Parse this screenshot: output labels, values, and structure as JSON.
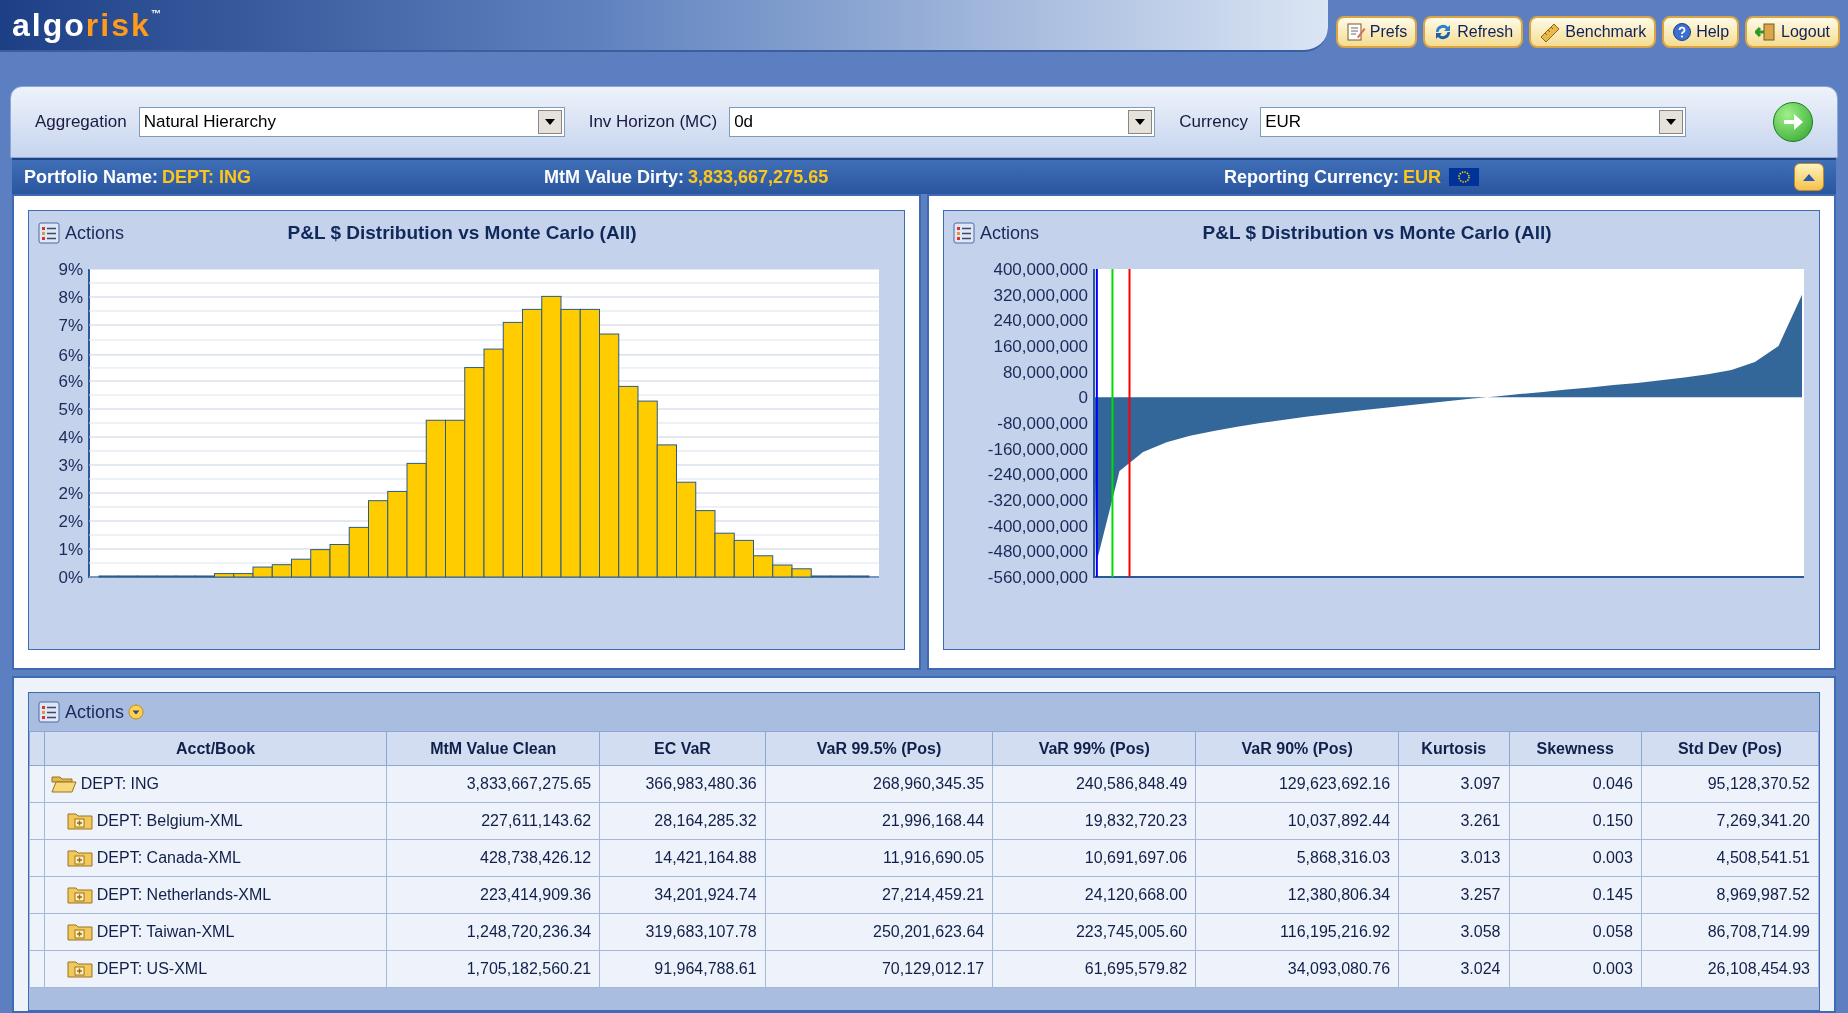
{
  "header": {
    "logo": {
      "first": "algo",
      "second": "risk",
      "mark": "™"
    },
    "buttons": [
      {
        "label": "Prefs"
      },
      {
        "label": "Refresh"
      },
      {
        "label": "Benchmark"
      },
      {
        "label": "Help"
      },
      {
        "label": "Logout"
      }
    ]
  },
  "filters": [
    {
      "label": "Aggregation",
      "value": "Natural Hierarchy"
    },
    {
      "label": "Inv Horizon (MC)",
      "value": "0d"
    },
    {
      "label": "Currency",
      "value": "EUR"
    }
  ],
  "info_bar": [
    {
      "label": "Portfolio Name:",
      "value": "DEPT: ING"
    },
    {
      "label": "MtM Value Dirty:",
      "value": "3,833,667,275.65"
    },
    {
      "label": "Reporting Currency:",
      "value": "EUR"
    }
  ],
  "charts": [
    {
      "actions": "Actions",
      "chart_data": {
        "type": "bar",
        "title": "P&L $ Distribution vs Monte Carlo (All)",
        "ylim": [
          0,
          9
        ],
        "yticks": [
          {
            "value": 0,
            "label": "0%"
          },
          {
            "value": 0.818,
            "label": "1%"
          },
          {
            "value": 1.636,
            "label": "2%"
          },
          {
            "value": 2.455,
            "label": "2%"
          },
          {
            "value": 3.273,
            "label": "3%"
          },
          {
            "value": 4.091,
            "label": "4%"
          },
          {
            "value": 4.909,
            "label": "5%"
          },
          {
            "value": 5.727,
            "label": "6%"
          },
          {
            "value": 6.49,
            "label": "6%"
          },
          {
            "value": 7.364,
            "label": "7%"
          },
          {
            "value": 8.182,
            "label": "8%"
          },
          {
            "value": 9,
            "label": "9%"
          }
        ],
        "grid": true,
        "series": [
          {
            "color": "#ffcc00",
            "values": [
              0.03,
              0.03,
              0.03,
              0.03,
              0.03,
              0.03,
              0.1,
              0.1,
              0.29,
              0.36,
              0.52,
              0.8,
              0.95,
              1.45,
              2.23,
              2.5,
              3.32,
              4.58,
              4.58,
              6.12,
              6.66,
              7.44,
              7.82,
              8.2,
              7.82,
              7.82,
              7.1,
              5.57,
              5.14,
              3.86,
              2.77,
              1.94,
              1.28,
              1.07,
              0.62,
              0.35,
              0.24,
              0.03,
              0.03,
              0.03
            ]
          }
        ]
      }
    },
    {
      "actions": "Actions",
      "chart_data": {
        "type": "area",
        "title": "P&L $ Distribution vs Monte Carlo (All)",
        "ylim": [
          -560000000,
          400000000
        ],
        "yticks": [
          {
            "value": 400000000,
            "label": "400,000,000"
          },
          {
            "value": 320000000,
            "label": "320,000,000"
          },
          {
            "value": 240000000,
            "label": "240,000,000"
          },
          {
            "value": 160000000,
            "label": "160,000,000"
          },
          {
            "value": 80000000,
            "label": "80,000,000"
          },
          {
            "value": 0,
            "label": "0"
          },
          {
            "value": -80000000,
            "label": "-80,000,000"
          },
          {
            "value": -160000000,
            "label": "-160,000,000"
          },
          {
            "value": -240000000,
            "label": "-240,000,000"
          },
          {
            "value": -320000000,
            "label": "-320,000,000"
          },
          {
            "value": -400000000,
            "label": "-400,000,000"
          },
          {
            "value": -480000000,
            "label": "-480,000,000"
          },
          {
            "value": -560000000,
            "label": "-560,000,000"
          }
        ],
        "series": [
          {
            "color": "#336699",
            "values": [
              -520000000,
              -230000000,
              -170000000,
              -140000000,
              -120000000,
              -105000000,
              -92000000,
              -80000000,
              -70000000,
              -60000000,
              -51000000,
              -43000000,
              -35000000,
              -27000000,
              -19000000,
              -11000000,
              -4000000,
              3000000,
              10000000,
              17000000,
              24000000,
              31000000,
              38000000,
              45000000,
              53000000,
              62000000,
              72000000,
              85000000,
              110000000,
              160000000,
              320000000
            ]
          }
        ]
      }
    }
  ],
  "table": {
    "actions": "Actions",
    "columns": [
      "Acct/Book",
      "MtM Value Clean",
      "EC VaR",
      "VaR 99.5% (Pos)",
      "VaR 99% (Pos)",
      "VaR 90% (Pos)",
      "Kurtosis",
      "Skewness",
      "Std Dev (Pos)"
    ],
    "rows": [
      {
        "expanded": true,
        "cells": [
          "DEPT: ING",
          "3,833,667,275.65",
          "366,983,480.36",
          "268,960,345.35",
          "240,586,848.49",
          "129,623,692.16",
          "3.097",
          "0.046",
          "95,128,370.52"
        ],
        "children": [
          {
            "expanded": false,
            "cells": [
              "DEPT: Belgium-XML",
              "227,611,143.62",
              "28,164,285.32",
              "21,996,168.44",
              "19,832,720.23",
              "10,037,892.44",
              "3.261",
              "0.150",
              "7,269,341.20"
            ]
          },
          {
            "expanded": false,
            "cells": [
              "DEPT: Canada-XML",
              "428,738,426.12",
              "14,421,164.88",
              "11,916,690.05",
              "10,691,697.06",
              "5,868,316.03",
              "3.013",
              "0.003",
              "4,508,541.51"
            ]
          },
          {
            "expanded": false,
            "cells": [
              "DEPT: Netherlands-XML",
              "223,414,909.36",
              "34,201,924.74",
              "27,214,459.21",
              "24,120,668.00",
              "12,380,806.34",
              "3.257",
              "0.145",
              "8,969,987.52"
            ]
          },
          {
            "expanded": false,
            "cells": [
              "DEPT: Taiwan-XML",
              "1,248,720,236.34",
              "319,683,107.78",
              "250,201,623.64",
              "223,745,005.60",
              "116,195,216.92",
              "3.058",
              "0.058",
              "86,708,714.99"
            ]
          },
          {
            "expanded": false,
            "cells": [
              "DEPT: US-XML",
              "1,705,182,560.21",
              "91,964,788.61",
              "70,129,012.17",
              "61,695,579.82",
              "34,093,080.76",
              "3.024",
              "0.003",
              "26,108,454.93"
            ]
          }
        ]
      }
    ]
  }
}
